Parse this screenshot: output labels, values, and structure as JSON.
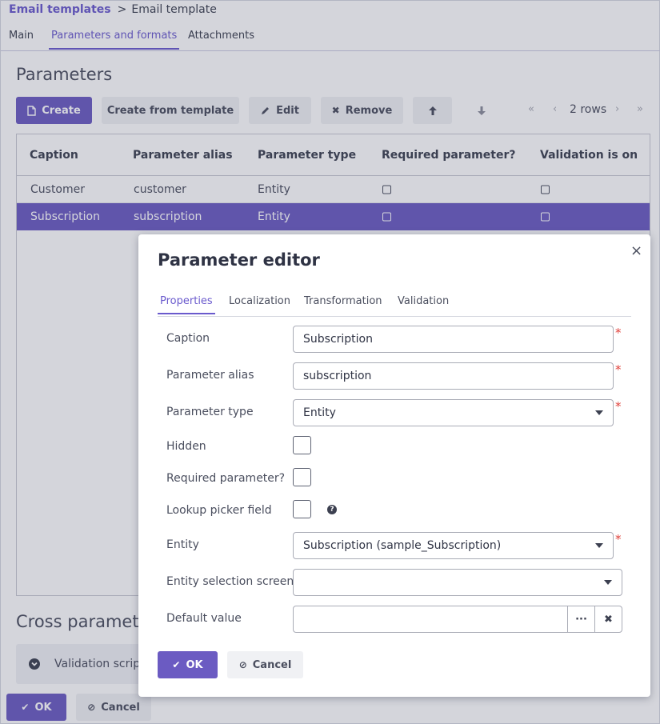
{
  "breadcrumb": {
    "parent": "Email templates",
    "separator": ">",
    "current": "Email template"
  },
  "tabs": [
    "Main",
    "Parameters and formats",
    "Attachments"
  ],
  "active_tab": "Parameters and formats",
  "parameters": {
    "title": "Parameters",
    "toolbar": {
      "create": "Create",
      "create_from_template": "Create from template",
      "edit": "Edit",
      "remove": "Remove",
      "move_up_icon": "arrow-up-icon",
      "move_down_icon": "arrow-down-icon"
    },
    "pager": {
      "first": "«",
      "prev": "‹",
      "text": "2 rows",
      "next": "›",
      "last": "»"
    },
    "columns": [
      "Caption",
      "Parameter alias",
      "Parameter type",
      "Required parameter?",
      "Validation is on"
    ],
    "rows": [
      {
        "caption": "Customer",
        "alias": "customer",
        "type": "Entity",
        "required": false,
        "validation": false
      },
      {
        "caption": "Subscription",
        "alias": "subscription",
        "type": "Entity",
        "required": false,
        "validation": false
      }
    ],
    "selected_row": 1
  },
  "cross": {
    "title": "Cross parameter",
    "validation_label": "Validation script"
  },
  "footer": {
    "ok": "OK",
    "cancel": "Cancel"
  },
  "dialog": {
    "title": "Parameter editor",
    "close": "×",
    "tabs": [
      "Properties",
      "Localization",
      "Transformation",
      "Validation"
    ],
    "active_tab": "Properties",
    "fields": {
      "caption_label": "Caption",
      "caption_value": "Subscription",
      "alias_label": "Parameter alias",
      "alias_value": "subscription",
      "type_label": "Parameter type",
      "type_value": "Entity",
      "hidden_label": "Hidden",
      "required_label": "Required parameter?",
      "lookup_label": "Lookup picker field",
      "entity_label": "Entity",
      "entity_value": "Subscription (sample_Subscription)",
      "screen_label": "Entity selection screen",
      "screen_value": "",
      "default_label": "Default value",
      "default_value": ""
    },
    "required_marker": "*",
    "help_glyph": "?",
    "picker_ellipsis": "···",
    "picker_clear": "✖",
    "ok": "OK",
    "cancel": "Cancel"
  },
  "colors": {
    "accent": "#6b5bc2",
    "required": "#e0403a"
  }
}
